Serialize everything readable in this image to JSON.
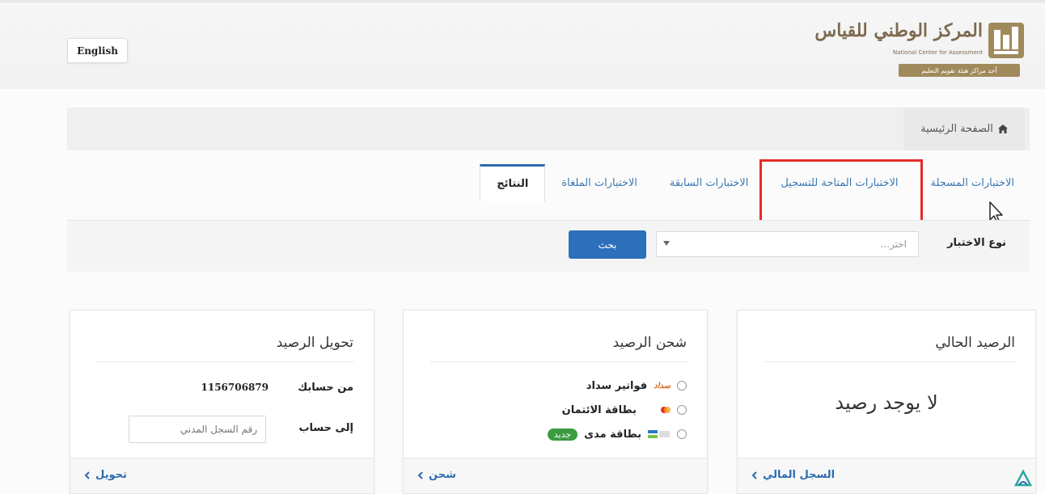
{
  "header": {
    "language_button": "English",
    "logo": {
      "name_ar": "المركز الوطني للقياس",
      "name_en": "National Center for Assessment",
      "tagline": "أحد مراكز هيئة تقويم التعليم"
    }
  },
  "breadcrumb": {
    "home_label": "الصفحة الرئيسية"
  },
  "tabs": [
    {
      "label": "الاختبارات المسجلة",
      "active": false
    },
    {
      "label": "الاختبارات المتاحة للتسجيل",
      "active": false,
      "highlighted": true
    },
    {
      "label": "الاختبارات السابقة",
      "active": false
    },
    {
      "label": "الاختبارات الملغاة",
      "active": false
    },
    {
      "label": "النتائج",
      "active": true
    }
  ],
  "filter": {
    "label": "نوع الاختبار",
    "select_placeholder": "اختر...",
    "search_button": "بحث"
  },
  "cards": {
    "balance": {
      "title": "الرصيد الحالي",
      "value_text": "لا يوجد رصيد",
      "footer_link": "السجل المالي"
    },
    "recharge": {
      "title": "شحن الرصيد",
      "options": [
        {
          "label": "فواتير سداد",
          "brand": "سداد"
        },
        {
          "label": "بطاقة الائتمان",
          "brand": "visa-mastercard-icon"
        },
        {
          "label": "بطاقة مدى",
          "brand": "mada-icon",
          "badge": "جديد"
        }
      ],
      "footer_link": "شحن"
    },
    "transfer": {
      "title": "تحويل الرصيد",
      "from_label": "من حسابك",
      "from_value": "1156706879",
      "to_label": "إلى حساب",
      "to_placeholder": "رقم السجل المدني",
      "footer_link": "تحويل"
    }
  },
  "colors": {
    "primary": "#2c6fbb",
    "link": "#2b6cb0",
    "highlight": "#e52a2a",
    "badge_green": "#3a9b3f",
    "logo_gold": "#a08a5c"
  }
}
